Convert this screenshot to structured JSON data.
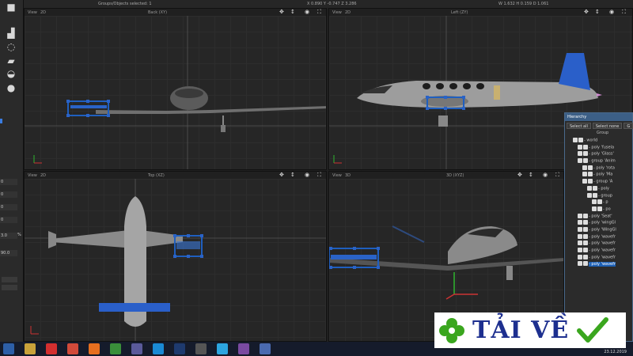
{
  "topbar": {
    "selection": "Groups/Objects selected: 1",
    "position": "X 0.890  Y -0.747  Z 3.286",
    "dimensions": "W 1.632  H 0.159  D 1.061"
  },
  "left_fields": [
    "0",
    "0",
    "0",
    "0",
    "3.0",
    "%",
    "90.0"
  ],
  "viewports": [
    {
      "view_label": "View",
      "dim": "2D",
      "name": "Back (XY)"
    },
    {
      "view_label": "View",
      "dim": "2D",
      "name": "Left (ZY)"
    },
    {
      "view_label": "View",
      "dim": "2D",
      "name": "Top (XZ)"
    },
    {
      "view_label": "View",
      "dim": "3D",
      "name": "3D (XYZ)"
    }
  ],
  "hierarchy": {
    "title": "Hierarchy",
    "select_all": "Select all",
    "select_none": "Select none",
    "third_button": "G",
    "column_header": "Group",
    "rows": [
      {
        "indent": 0,
        "label": "- world",
        "selected": false
      },
      {
        "indent": 1,
        "label": "- poly 'fusela",
        "selected": false
      },
      {
        "indent": 1,
        "label": "- poly 'Glass'",
        "selected": false
      },
      {
        "indent": 1,
        "label": "- group 'Anim",
        "selected": false
      },
      {
        "indent": 2,
        "label": "- poly 'rota",
        "selected": false
      },
      {
        "indent": 2,
        "label": "- poly 'Ma",
        "selected": false
      },
      {
        "indent": 2,
        "label": "- group 'A",
        "selected": false
      },
      {
        "indent": 3,
        "label": "- poly",
        "selected": false
      },
      {
        "indent": 3,
        "label": "- group",
        "selected": false
      },
      {
        "indent": 4,
        "label": "- p",
        "selected": false
      },
      {
        "indent": 4,
        "label": "- po",
        "selected": false
      },
      {
        "indent": 1,
        "label": "- poly 'Seat'",
        "selected": false
      },
      {
        "indent": 1,
        "label": "- poly 'wingGl",
        "selected": false
      },
      {
        "indent": 1,
        "label": "- poly 'WingGl",
        "selected": false
      },
      {
        "indent": 1,
        "label": "- poly 'wavefr",
        "selected": false
      },
      {
        "indent": 1,
        "label": "- poly 'wavefr",
        "selected": false
      },
      {
        "indent": 1,
        "label": "- poly 'wavefr",
        "selected": false
      },
      {
        "indent": 1,
        "label": "- poly 'wavefr",
        "selected": false
      },
      {
        "indent": 1,
        "label": "- poly 'wavefr",
        "selected": true
      }
    ]
  },
  "taskbar": {
    "date": "23.12.2019",
    "apps": [
      "windows-6-icon",
      "file-manager-icon",
      "opera-icon",
      "media-player-icon",
      "firefox-icon",
      "chrome-icon",
      "floppy-icon",
      "skype-icon",
      "photoshop-icon",
      "app-6-icon",
      "telegram-icon",
      "eye-app-icon",
      "modeler-icon"
    ]
  },
  "watermark": {
    "text": "TẢI VỀ",
    "clover_color": "#3aa61e",
    "check_color": "#3aa61e"
  },
  "colors": {
    "selection": "#1f5fbf",
    "handle": "#1f5fbf",
    "wing_tip": "#2a5fc9",
    "fin": "#2a5fc9"
  }
}
